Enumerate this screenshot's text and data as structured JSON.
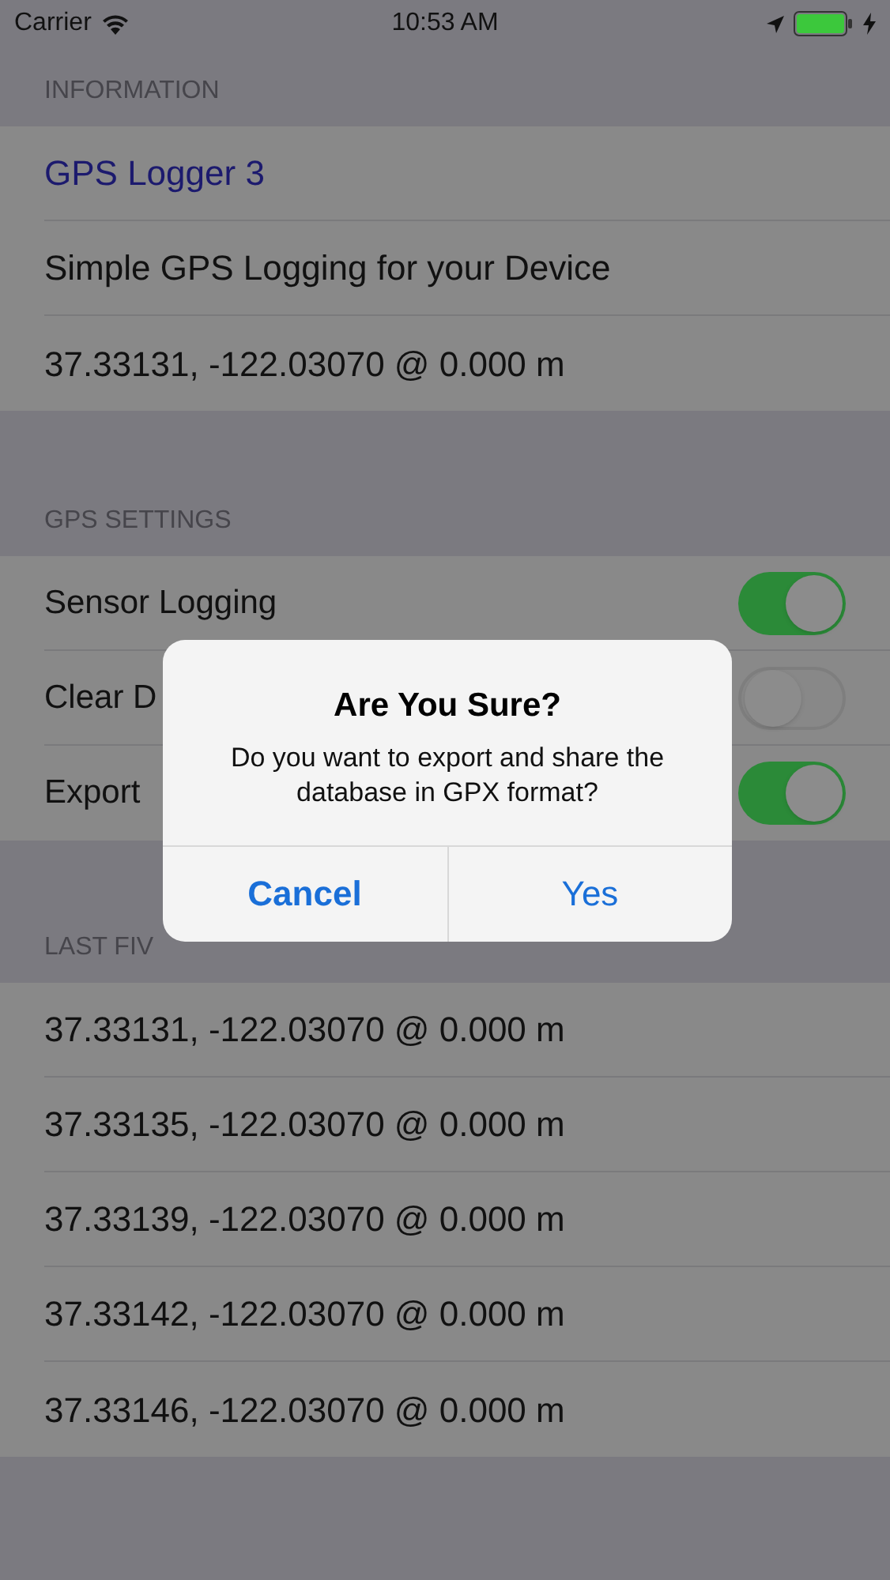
{
  "status_bar": {
    "carrier": "Carrier",
    "time": "10:53 AM"
  },
  "sections": [
    {
      "header": "INFORMATION",
      "rows": [
        {
          "kind": "link",
          "text": "GPS Logger 3"
        },
        {
          "kind": "text",
          "text": "Simple GPS Logging for your Device"
        },
        {
          "kind": "text",
          "text": "37.33131, -122.03070 @ 0.000 m"
        }
      ]
    },
    {
      "header": "GPS SETTINGS",
      "rows": [
        {
          "kind": "toggle",
          "text": "Sensor Logging",
          "on": true
        },
        {
          "kind": "toggle",
          "text": "Clear D",
          "on": false
        },
        {
          "kind": "toggle",
          "text": "Export",
          "on": true
        }
      ]
    },
    {
      "header": "LAST FIV",
      "rows": [
        {
          "kind": "text",
          "text": "37.33131, -122.03070 @ 0.000 m"
        },
        {
          "kind": "text",
          "text": "37.33135, -122.03070 @ 0.000 m"
        },
        {
          "kind": "text",
          "text": "37.33139, -122.03070 @ 0.000 m"
        },
        {
          "kind": "text",
          "text": "37.33142, -122.03070 @ 0.000 m"
        },
        {
          "kind": "text",
          "text": "37.33146, -122.03070 @ 0.000 m"
        }
      ]
    }
  ],
  "alert": {
    "title": "Are You Sure?",
    "message": "Do you want to export and share the database in GPX format?",
    "buttons": [
      {
        "label": "Cancel",
        "bold": true
      },
      {
        "label": "Yes",
        "bold": false
      }
    ]
  }
}
